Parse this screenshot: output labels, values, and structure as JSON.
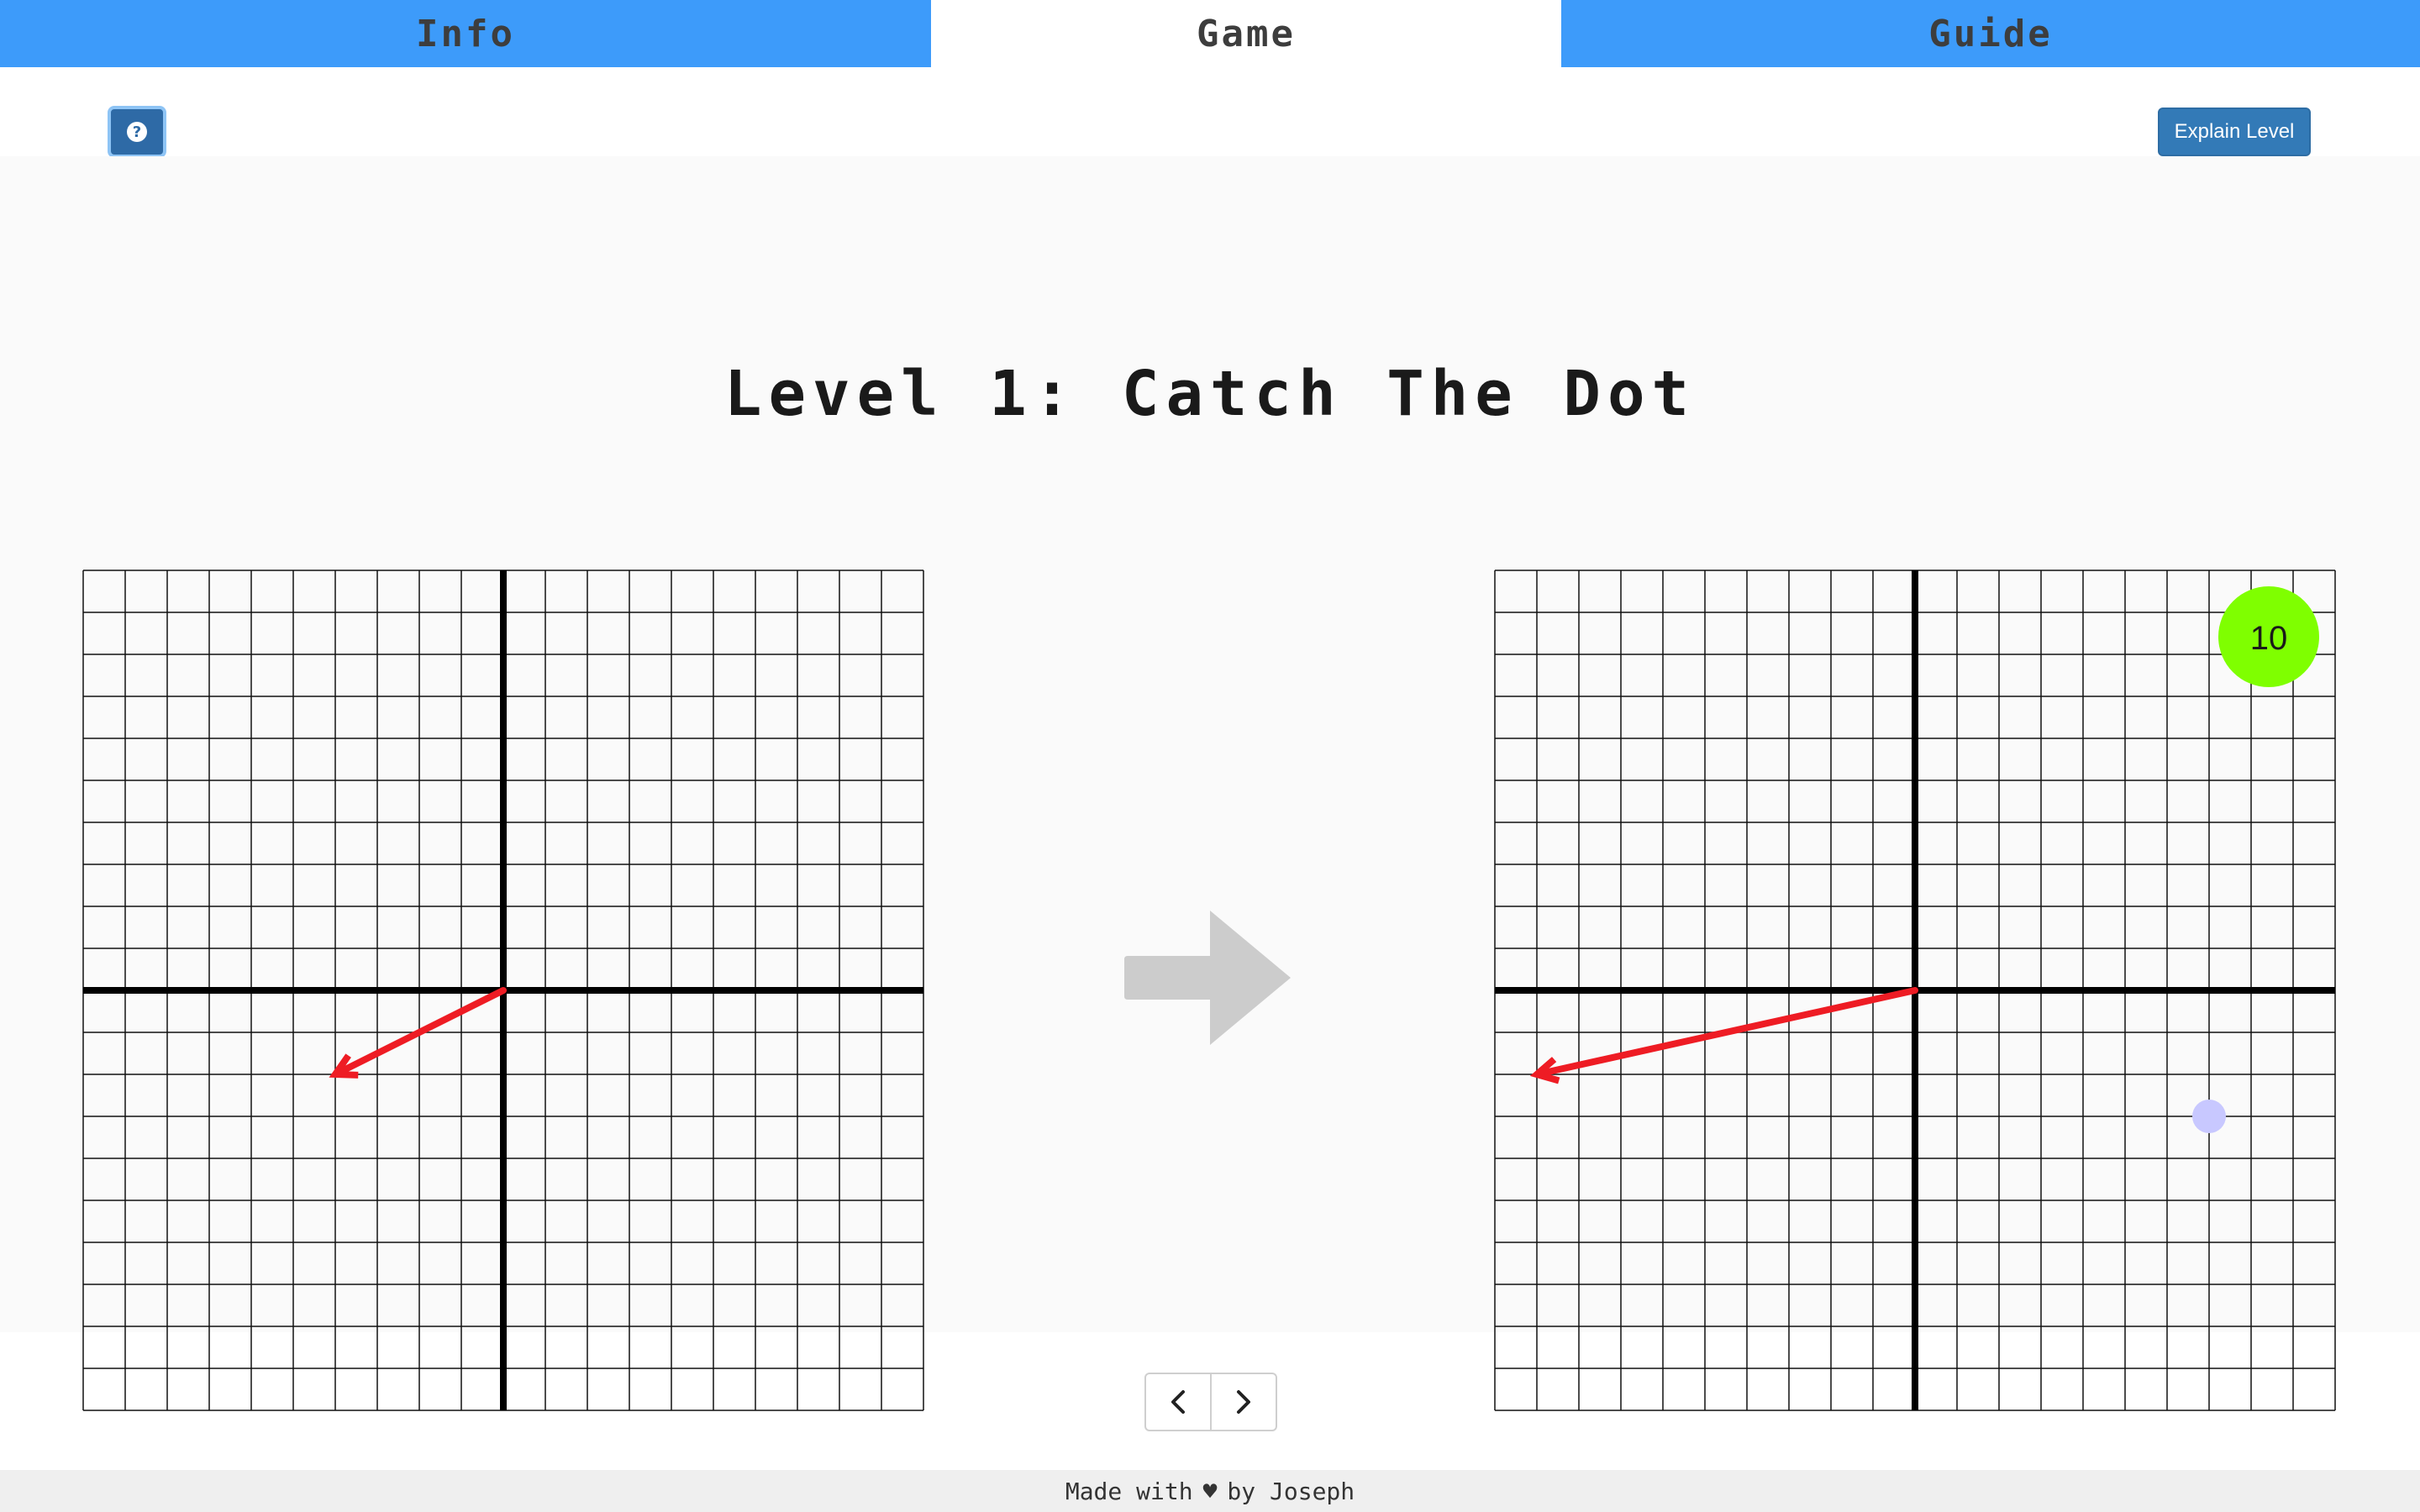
{
  "tabs": [
    {
      "label": "Info",
      "active": false
    },
    {
      "label": "Game",
      "active": true
    },
    {
      "label": "Guide",
      "active": false
    }
  ],
  "toolbar": {
    "help_icon": "question-circle-icon",
    "explain_label": "Explain Level"
  },
  "level": {
    "title": "Level 1: Catch The Dot"
  },
  "input_grid": {
    "vector": [
      -4,
      -2
    ]
  },
  "output_grid": {
    "vector": [
      -9,
      -2
    ],
    "dot": [
      7,
      -3
    ],
    "score": "10",
    "score_color": "#7fff00"
  },
  "colors": {
    "tab": "#3d9bfa",
    "vector": "#ee1c24",
    "dot": "#c8c8ff",
    "arrow": "#cccccc",
    "primary_button": "#337ab7"
  },
  "pager": {
    "prev_icon": "chevron-left-icon",
    "next_icon": "chevron-right-icon"
  },
  "footer": {
    "prefix": "Made with",
    "heart": "♥",
    "suffix": "by Joseph"
  }
}
